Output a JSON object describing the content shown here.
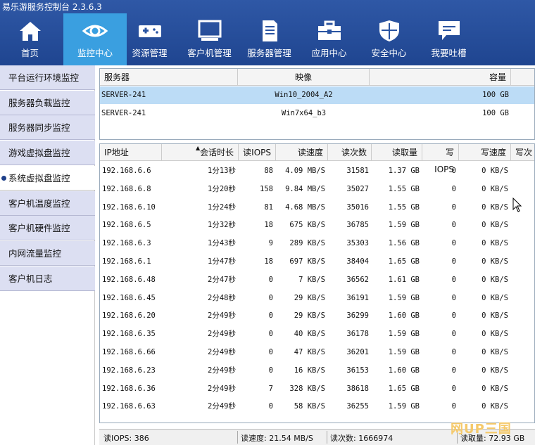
{
  "app": {
    "title": "易乐游服务控制台 2.3.6.3"
  },
  "nav": [
    {
      "label": "首页",
      "icon": "home-icon"
    },
    {
      "label": "监控中心",
      "icon": "eye-icon",
      "active": true
    },
    {
      "label": "资源管理",
      "icon": "gamepad-icon"
    },
    {
      "label": "客户机管理",
      "icon": "monitor-icon"
    },
    {
      "label": "服务器管理",
      "icon": "server-icon"
    },
    {
      "label": "应用中心",
      "icon": "toolbox-icon"
    },
    {
      "label": "安全中心",
      "icon": "shield-icon"
    },
    {
      "label": "我要吐槽",
      "icon": "chat-icon"
    }
  ],
  "sidebar": [
    {
      "label": "平台运行环境监控"
    },
    {
      "label": "服务器负载监控"
    },
    {
      "label": "服务器同步监控"
    },
    {
      "label": "游戏虚拟盘监控"
    },
    {
      "label": "系统虚拟盘监控",
      "active": true
    },
    {
      "label": "客户机温度监控"
    },
    {
      "label": "客户机硬件监控"
    },
    {
      "label": "内网流量监控"
    },
    {
      "label": "客户机日志"
    }
  ],
  "servers": {
    "headers": [
      "服务器",
      "映像",
      "容量"
    ],
    "rows": [
      {
        "server": "SERVER-241",
        "image": "Win10_2004_A2",
        "capacity": "100 GB",
        "selected": true
      },
      {
        "server": "SERVER-241",
        "image": "Win7x64_b3",
        "capacity": "100 GB"
      }
    ]
  },
  "clients": {
    "headers": [
      "IP地址",
      "会话时长",
      "读IOPS",
      "读速度",
      "读次数",
      "读取量",
      "写IOPS",
      "写速度",
      "写次"
    ],
    "rows": [
      [
        "192.168.6.6",
        "1分13秒",
        "88",
        "4.09 MB/S",
        "31581",
        "1.37 GB",
        "0",
        "0 KB/S"
      ],
      [
        "192.168.6.8",
        "1分20秒",
        "158",
        "9.84 MB/S",
        "35027",
        "1.55 GB",
        "0",
        "0 KB/S"
      ],
      [
        "192.168.6.10",
        "1分24秒",
        "81",
        "4.68 MB/S",
        "35016",
        "1.55 GB",
        "0",
        "0 KB/S"
      ],
      [
        "192.168.6.5",
        "1分32秒",
        "18",
        "675 KB/S",
        "36785",
        "1.59 GB",
        "0",
        "0 KB/S"
      ],
      [
        "192.168.6.3",
        "1分43秒",
        "9",
        "289 KB/S",
        "35303",
        "1.56 GB",
        "0",
        "0 KB/S"
      ],
      [
        "192.168.6.1",
        "1分47秒",
        "18",
        "697 KB/S",
        "38404",
        "1.65 GB",
        "0",
        "0 KB/S"
      ],
      [
        "192.168.6.48",
        "2分47秒",
        "0",
        "7 KB/S",
        "36562",
        "1.61 GB",
        "0",
        "0 KB/S"
      ],
      [
        "192.168.6.45",
        "2分48秒",
        "0",
        "29 KB/S",
        "36191",
        "1.59 GB",
        "0",
        "0 KB/S"
      ],
      [
        "192.168.6.20",
        "2分49秒",
        "0",
        "29 KB/S",
        "36299",
        "1.60 GB",
        "0",
        "0 KB/S"
      ],
      [
        "192.168.6.35",
        "2分49秒",
        "0",
        "40 KB/S",
        "36178",
        "1.59 GB",
        "0",
        "0 KB/S"
      ],
      [
        "192.168.6.66",
        "2分49秒",
        "0",
        "47 KB/S",
        "36201",
        "1.59 GB",
        "0",
        "0 KB/S"
      ],
      [
        "192.168.6.23",
        "2分49秒",
        "0",
        "16 KB/S",
        "36153",
        "1.60 GB",
        "0",
        "0 KB/S"
      ],
      [
        "192.168.6.36",
        "2分49秒",
        "7",
        "328 KB/S",
        "38618",
        "1.65 GB",
        "0",
        "0 KB/S"
      ],
      [
        "192.168.6.63",
        "2分49秒",
        "0",
        "58 KB/S",
        "36255",
        "1.59 GB",
        "0",
        "0 KB/S"
      ]
    ]
  },
  "status": {
    "read_iops": "读IOPS: 386",
    "read_speed": "读速度: 21.54 MB/S",
    "read_count": "读次数: 1666974",
    "read_total": "读取量: 72.93 GB"
  },
  "watermark": "网UP三国"
}
